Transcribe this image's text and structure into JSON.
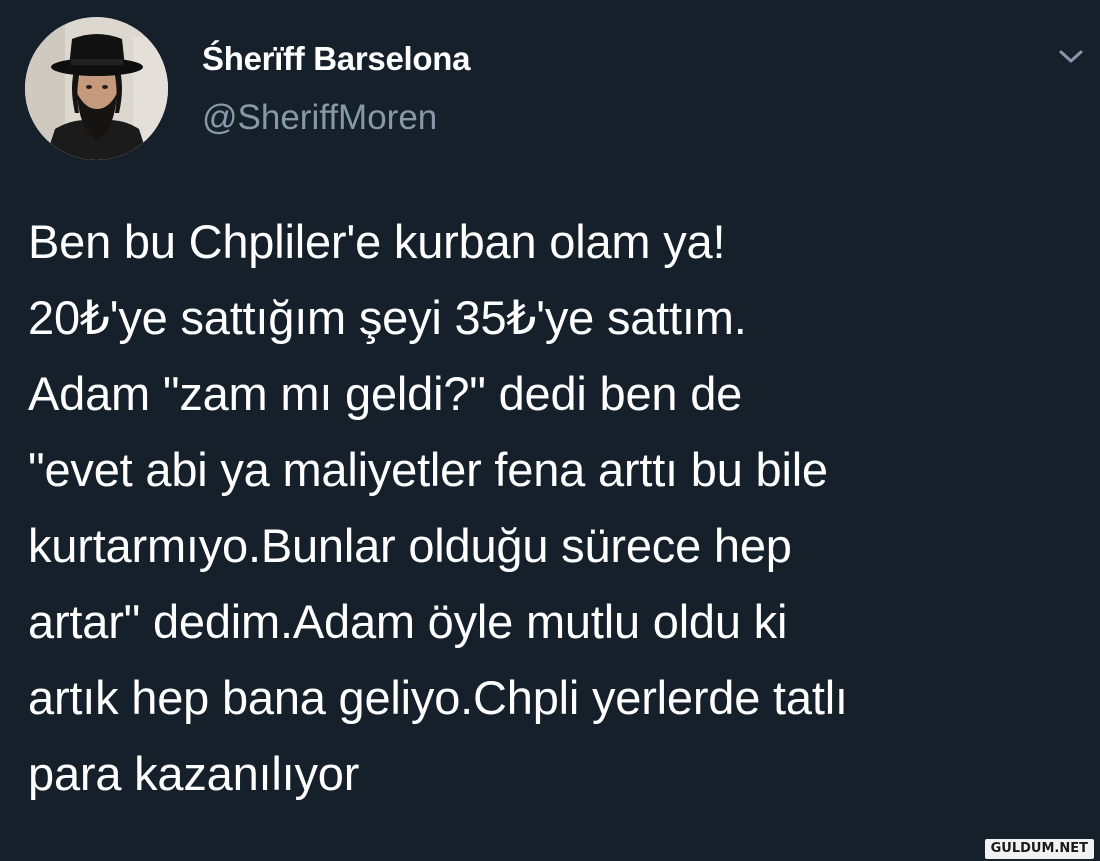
{
  "user": {
    "display_name": "Śherïff Barselona",
    "handle": "@SheriffMoren",
    "avatar_icon": "profile-photo-man-black-hat-beard"
  },
  "menu": {
    "icon": "chevron-down-icon"
  },
  "tweet": {
    "lines": [
      "Ben bu Chpliler'e kurban olam ya!",
      "20₺'ye sattığım şeyi 35₺'ye sattım.",
      "Adam \"zam mı geldi?\" dedi ben de",
      "\"evet abi ya maliyetler fena arttı bu bile",
      "kurtarmıyo.Bunlar olduğu sürece hep",
      "artar\" dedim.Adam öyle mutlu oldu ki",
      "artık hep bana geliyo.Chpli yerlerde tatlı",
      "para kazanılıyor"
    ]
  },
  "watermark": {
    "text": "GULDUM.NET"
  },
  "colors": {
    "background": "#15202b",
    "text": "#ffffff",
    "secondary_text": "#8899a6"
  }
}
